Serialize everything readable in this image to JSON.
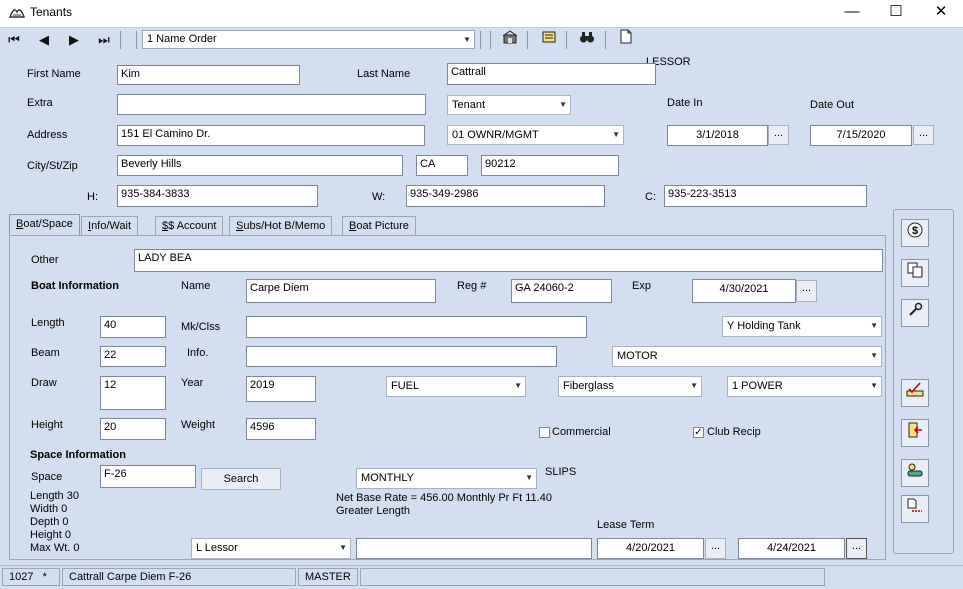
{
  "window": {
    "title": "Tenants",
    "minimize": "—",
    "maximize": "☐",
    "close": "✕"
  },
  "toolbar": {
    "first": "⏮",
    "prev": "◀",
    "next": "▶",
    "last": "⏭",
    "order_value": "1 Name Order",
    "icons": [
      "building-icon",
      "note-icon",
      "binoculars-icon",
      "page-icon"
    ]
  },
  "header": {
    "lessor_label": "LESSOR",
    "first_name_label": "First Name",
    "first_name": "Kim",
    "last_name_label": "Last Name",
    "last_name": "Cattrall",
    "extra_label": "Extra",
    "extra": "",
    "type_value": "Tenant",
    "date_in_label": "Date In",
    "date_in": "3/1/2018",
    "date_out_label": "Date Out",
    "date_out": "7/15/2020",
    "address_label": "Address",
    "address": "151 El Camino Dr.",
    "category_value": "01  OWNR/MGMT",
    "city_label": "City/St/Zip",
    "city": "Beverly Hills",
    "state": "CA",
    "zip": "90212",
    "h_label": "H:",
    "h_phone": "935-384-3833",
    "w_label": "W:",
    "w_phone": "935-349-2986",
    "c_label": "C:",
    "c_phone": "935-223-3513",
    "dots": "..."
  },
  "tabs": [
    "Boat/Space",
    "Info/Wait",
    "$$ Account",
    "Subs/Hot B/Memo",
    "Boat Picture"
  ],
  "boat": {
    "other_label": "Other",
    "other": "LADY BEA",
    "section_label": "Boat Information",
    "name_label": "Name",
    "name": "Carpe Diem",
    "reg_label": "Reg #",
    "reg": "GA 24060-2",
    "exp_label": "Exp",
    "exp": "4/30/2021",
    "length_label": "Length",
    "length": "40",
    "mkclss_label": "Mk/Clss",
    "mkclss": "",
    "holding_value": "Y Holding Tank",
    "beam_label": "Beam",
    "beam": "22",
    "info_label": "Info.",
    "info": "",
    "motor_value": "MOTOR",
    "draw_label": "Draw",
    "draw": "12",
    "year_label": "Year",
    "year": "2019",
    "fuel_value": "FUEL",
    "hull_value": "Fiberglass",
    "power_value": "1  POWER",
    "height_label": "Height",
    "height": "20",
    "weight_label": "Weight",
    "weight": "4596",
    "commercial_label": "Commercial",
    "commercial_checked": false,
    "clubrecip_label": "Club Recip",
    "clubrecip_checked": true
  },
  "space": {
    "section_label": "Space Information",
    "space_label": "Space",
    "space": "F-26",
    "search_label": "Search",
    "rate_value": "MONTHLY",
    "slips_label": "SLIPS",
    "net_rate": "Net Base Rate = 456.00 Monthly Pr Ft 11.40",
    "greater_length": "Greater Length",
    "length_line": "Length  30",
    "width_line": "Width  0",
    "depth_line": "Depth  0",
    "height_line": "Height 0",
    "maxwt_line": "Max Wt. 0",
    "lease_term_label": "Lease Term",
    "lessor_value": "L Lessor",
    "lease_note": "",
    "lease_start": "4/20/2021",
    "lease_end": "4/24/2021"
  },
  "rightbar": {
    "icons": [
      "dollar-icon",
      "copy-icon",
      "wrench-icon",
      "edit-check-icon",
      "exit-door-icon",
      "people-car-icon",
      "transfer-page-icon"
    ]
  },
  "status": {
    "id": "1027",
    "flag": "*",
    "summary": "Cattrall  Carpe Diem  F-26",
    "user": "MASTER"
  },
  "colors": {
    "form_bg": "#d3def0",
    "field_bg": "#ffffff",
    "button_bg": "#e9eef6"
  }
}
